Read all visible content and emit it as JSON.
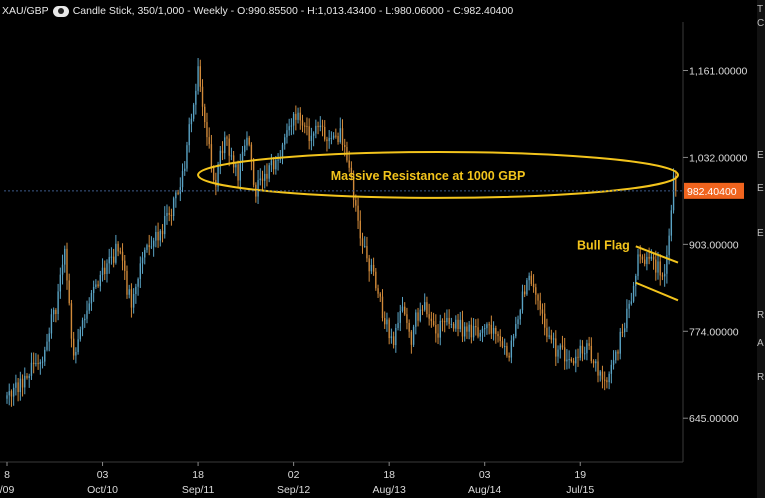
{
  "header": {
    "symbol": "XAU/GBP",
    "eye_icon": "eye-icon",
    "details": "Candle Stick, 350/1,000 - Weekly - O:990.85500 - H:1,013.43400 - L:980.06000 - C:982.40400"
  },
  "side_panel_letters": [
    "T",
    "C",
    "E",
    "E",
    "E",
    "R",
    "A",
    "R"
  ],
  "chart_data": {
    "type": "candlestick",
    "y_ticks": [
      {
        "value": 1161,
        "label": "1,161.00000"
      },
      {
        "value": 1032,
        "label": "1,032.00000"
      },
      {
        "value": 903,
        "label": "903.00000"
      },
      {
        "value": 774,
        "label": "774.00000"
      },
      {
        "value": 645,
        "label": "645.00000"
      }
    ],
    "ylim": [
      580,
      1230
    ],
    "x_ticks": [
      {
        "week": 0,
        "day": "8",
        "period": "/09"
      },
      {
        "week": 43,
        "day": "03",
        "period": "Oct/10"
      },
      {
        "week": 86,
        "day": "18",
        "period": "Sep/11"
      },
      {
        "week": 129,
        "day": "02",
        "period": "Sep/12"
      },
      {
        "week": 172,
        "day": "18",
        "period": "Aug/13"
      },
      {
        "week": 215,
        "day": "03",
        "period": "Aug/14"
      },
      {
        "week": 258,
        "day": "19",
        "period": "Jul/15"
      }
    ],
    "last_price": {
      "value": 982.404,
      "label": "982.40400"
    },
    "anchors": [
      [
        0,
        672
      ],
      [
        8,
        700
      ],
      [
        16,
        740
      ],
      [
        22,
        812
      ],
      [
        26,
        885
      ],
      [
        30,
        735
      ],
      [
        38,
        835
      ],
      [
        44,
        870
      ],
      [
        50,
        895
      ],
      [
        56,
        812
      ],
      [
        62,
        890
      ],
      [
        70,
        930
      ],
      [
        78,
        985
      ],
      [
        84,
        1110
      ],
      [
        86,
        1165
      ],
      [
        90,
        1060
      ],
      [
        94,
        990
      ],
      [
        98,
        1070
      ],
      [
        104,
        1000
      ],
      [
        108,
        1060
      ],
      [
        112,
        980
      ],
      [
        118,
        1015
      ],
      [
        124,
        1045
      ],
      [
        128,
        1080
      ],
      [
        132,
        1100
      ],
      [
        136,
        1060
      ],
      [
        140,
        1080
      ],
      [
        144,
        1050
      ],
      [
        150,
        1070
      ],
      [
        154,
        1020
      ],
      [
        158,
        935
      ],
      [
        162,
        880
      ],
      [
        166,
        845
      ],
      [
        170,
        790
      ],
      [
        174,
        760
      ],
      [
        178,
        820
      ],
      [
        182,
        765
      ],
      [
        186,
        815
      ],
      [
        190,
        805
      ],
      [
        194,
        775
      ],
      [
        198,
        795
      ],
      [
        204,
        780
      ],
      [
        210,
        772
      ],
      [
        216,
        780
      ],
      [
        222,
        768
      ],
      [
        226,
        740
      ],
      [
        230,
        800
      ],
      [
        234,
        852
      ],
      [
        238,
        820
      ],
      [
        242,
        780
      ],
      [
        246,
        752
      ],
      [
        250,
        740
      ],
      [
        254,
        722
      ],
      [
        258,
        752
      ],
      [
        262,
        748
      ],
      [
        266,
        710
      ],
      [
        270,
        708
      ],
      [
        274,
        745
      ],
      [
        278,
        780
      ],
      [
        282,
        840
      ],
      [
        284,
        898
      ],
      [
        287,
        875
      ],
      [
        290,
        872
      ],
      [
        293,
        865
      ],
      [
        296,
        852
      ],
      [
        298,
        920
      ],
      [
        300,
        1005
      ],
      [
        301,
        982.404
      ]
    ],
    "annotations": [
      {
        "text": "Massive Resistance at 1000 GBP",
        "shape": "ellipse",
        "x_range": [
          86,
          302
        ],
        "y_range": [
          972,
          1040
        ]
      },
      {
        "text": "Bull Flag",
        "shape": "channel",
        "upper": [
          [
            283,
            900
          ],
          [
            302,
            876
          ]
        ],
        "lower": [
          [
            283,
            846
          ],
          [
            302,
            820
          ]
        ]
      }
    ],
    "colors": {
      "up": "#5aa3c4",
      "down": "#d18a3a",
      "annotation": "#f3c41c",
      "last_price_tag": "#f0641e",
      "background": "#000000",
      "axis_text": "#dcdcdc"
    }
  }
}
